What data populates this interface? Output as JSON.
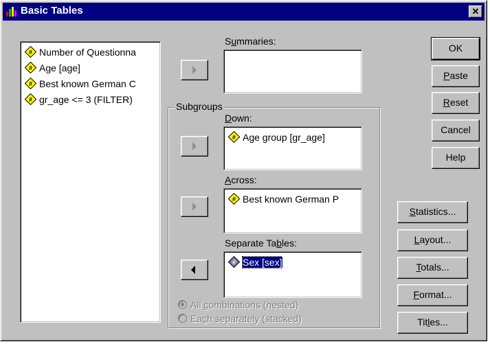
{
  "window": {
    "title": "Basic Tables",
    "close_glyph": "✕"
  },
  "variables": [
    {
      "label": "Number of Questionna",
      "icon": "numeric-variable-icon"
    },
    {
      "label": "Age [age]",
      "icon": "numeric-variable-icon"
    },
    {
      "label": "Best known German C",
      "icon": "numeric-variable-icon"
    },
    {
      "label": "gr_age <= 3 (FILTER)",
      "icon": "numeric-variable-icon"
    }
  ],
  "summaries": {
    "label_pre": "S",
    "label_ul": "u",
    "label_post": "mmaries:",
    "items": []
  },
  "subgroups": {
    "title": "Subgroups",
    "down": {
      "label_ul": "D",
      "label_post": "own:",
      "item": "Age group [gr_age]"
    },
    "across": {
      "label_ul": "A",
      "label_post": "cross:",
      "item": "Best known German P"
    },
    "separate": {
      "label_pre": "Separate Ta",
      "label_ul": "b",
      "label_post": "les:",
      "item": "Sex [sex]"
    },
    "radio_nested": {
      "pre": "All ",
      "ul": "c",
      "post": "ombinations (nested)"
    },
    "radio_stacked": {
      "pre": "Ea",
      "ul": "c",
      "post": "h separately (stacked)"
    }
  },
  "buttons": {
    "ok": "OK",
    "paste": {
      "ul": "P",
      "post": "aste"
    },
    "reset": {
      "ul": "R",
      "post": "eset"
    },
    "cancel": "Cancel",
    "help": "Help",
    "statistics": {
      "ul": "S",
      "post": "tatistics..."
    },
    "layout": {
      "ul": "L",
      "post": "ayout..."
    },
    "totals": {
      "ul": "T",
      "post": "otals..."
    },
    "format": {
      "ul": "F",
      "post": "ormat..."
    },
    "titles": {
      "pre": "Tit",
      "ul": "l",
      "post": "es..."
    }
  },
  "colors": {
    "titlebar": "#000080",
    "face": "#c0c0c0",
    "icon_yellow": "#ffff00"
  }
}
